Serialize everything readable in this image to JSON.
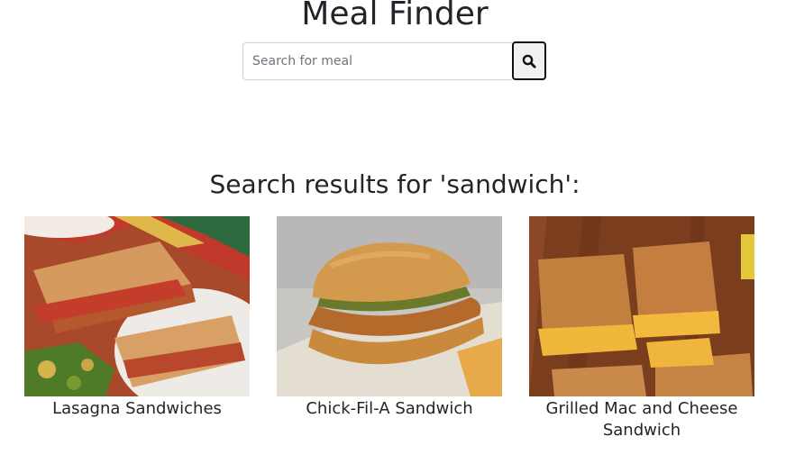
{
  "header": {
    "title": "Meal Finder"
  },
  "search": {
    "placeholder": "Search for meal",
    "value": "",
    "button_icon": "search-icon"
  },
  "results": {
    "heading": "Search results for 'sandwich':",
    "meals": [
      {
        "name": "Lasagna Sandwiches",
        "image": "grilled lasagna sandwiches photo"
      },
      {
        "name": "Chick-Fil-A Sandwich",
        "image": "fried chicken sandwich photo"
      },
      {
        "name": "Grilled Mac and Cheese Sandwich",
        "image": "grilled mac and cheese sandwich photo"
      }
    ]
  }
}
